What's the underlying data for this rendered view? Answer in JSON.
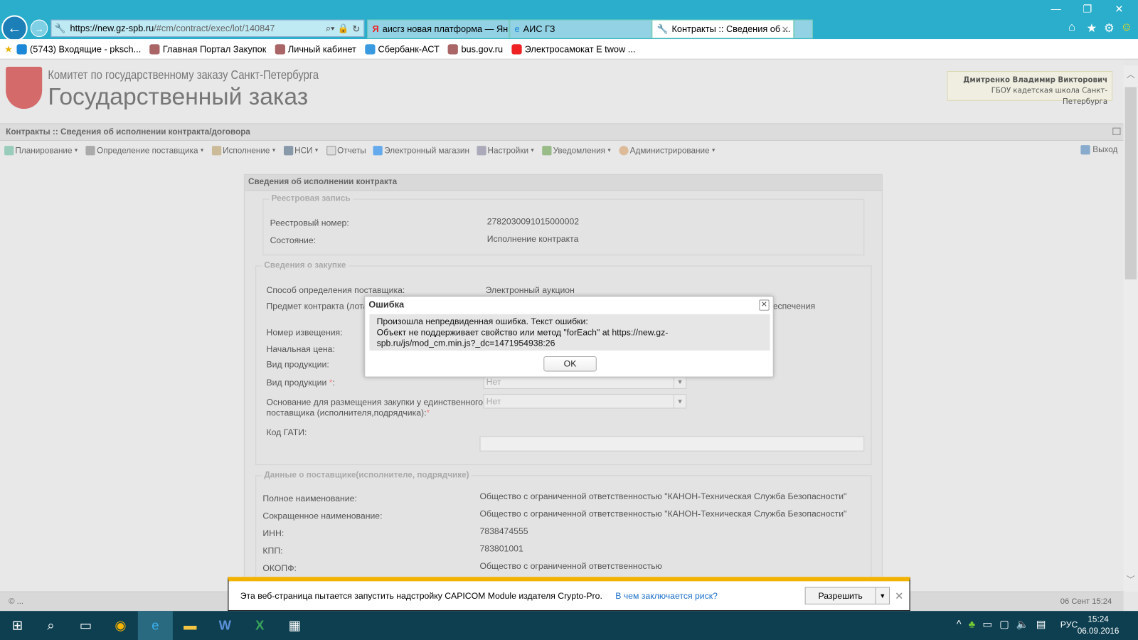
{
  "browser": {
    "url_prefix": "https://",
    "url_domain": "new.gz-spb.ru",
    "url_path": "/#cm/contract/exec/lot/140847",
    "tabs": [
      {
        "label": "аисгз новая платформа — Ян..."
      },
      {
        "label": "АИС ГЗ"
      },
      {
        "label": "Контракты :: Сведения об ..."
      }
    ],
    "favorites": [
      {
        "label": "(5743) Входящие - pksch..."
      },
      {
        "label": "Главная Портал Закупок"
      },
      {
        "label": "Личный кабинет"
      },
      {
        "label": "Сбербанк-АСТ"
      },
      {
        "label": "bus.gov.ru"
      },
      {
        "label": "Электросамокат E twow ..."
      }
    ]
  },
  "header": {
    "org_line1": "Комитет по государственному заказу Санкт-Петербурга",
    "org_line2": "Государственный заказ",
    "user_name": "Дмитренко Владимир Викторович",
    "user_org": "ГБОУ кадетская школа Санкт-Петербурга"
  },
  "breadcrumb": "Контракты :: Сведения об исполнении контракта/договора",
  "menu": [
    {
      "label": "Планирование",
      "dropdown": true
    },
    {
      "label": "Определение поставщика",
      "dropdown": true
    },
    {
      "label": "Исполнение",
      "dropdown": true
    },
    {
      "label": "НСИ",
      "dropdown": true
    },
    {
      "label": "Отчеты",
      "dropdown": false
    },
    {
      "label": "Электронный магазин",
      "dropdown": false
    },
    {
      "label": "Настройки",
      "dropdown": true
    },
    {
      "label": "Уведомления",
      "dropdown": true
    },
    {
      "label": "Администрирование",
      "dropdown": true
    }
  ],
  "exit_label": "Выход",
  "panel": {
    "title": "Сведения об исполнении контракта",
    "registry": {
      "legend": "Реестровая запись",
      "reg_number_label": "Реестровый номер:",
      "reg_number": "2782030091015000002",
      "state_label": "Состояние:",
      "state": "Исполнение контракта"
    },
    "purchase": {
      "legend": "Сведения о закупке",
      "method_label": "Способ определения поставщика:",
      "method": "Электронный аукцион",
      "subject_label": "Предмет контракта (лота",
      "subject_tail": "еспечения",
      "notice_label": "Номер извещения:",
      "price_label": "Начальная цена:",
      "product_label": "Вид продукции:",
      "product_req_label": "Вид продукции",
      "product_req_value": "Нет",
      "basis_label_1": "Основание для размещения закупки у единственного",
      "basis_label_2": "поставщика (исполнителя,подрядчика):",
      "basis_value": "Нет",
      "gati_label": "Код ГАТИ:",
      "gati_value": ""
    },
    "supplier": {
      "legend": "Данные о поставщике(исполнителе, подрядчике)",
      "full_name_label": "Полное наименование:",
      "full_name": "Общество с ограниченной ответственностью \"КАНОН-Техническая Служба Безопасности\"",
      "short_name_label": "Сокращенное наименование:",
      "short_name": "Общество с ограниченной ответственностью \"КАНОН-Техническая Служба Безопасности\"",
      "inn_label": "ИНН:",
      "inn": "7838474555",
      "kpp_label": "КПП:",
      "kpp": "783801001",
      "okopf_label": "ОКОПФ:",
      "okopf": "Общество с ограниченной ответственностью"
    }
  },
  "dialog": {
    "title": "Ошибка",
    "line1": "Произошла непредвиденная ошибка. Текст ошибки:",
    "line2": "Объект не поддерживает свойство или метод \"forEach\" at https://new.gz-",
    "line3": "spb.ru/js/mod_cm.min.js?_dc=1471954938:26",
    "ok_label": "OK"
  },
  "status": {
    "left": "© ...",
    "date": "06 Сент 15:24"
  },
  "notification": {
    "text": "Эта веб-страница пытается запустить надстройку CAPICOM Module издателя Crypto-Pro.",
    "risk_link": "В чем заключается риск?",
    "allow_label": "Разрешить"
  },
  "taskbar": {
    "lang": "РУС",
    "time": "15:24",
    "date": "06.09.2016"
  }
}
